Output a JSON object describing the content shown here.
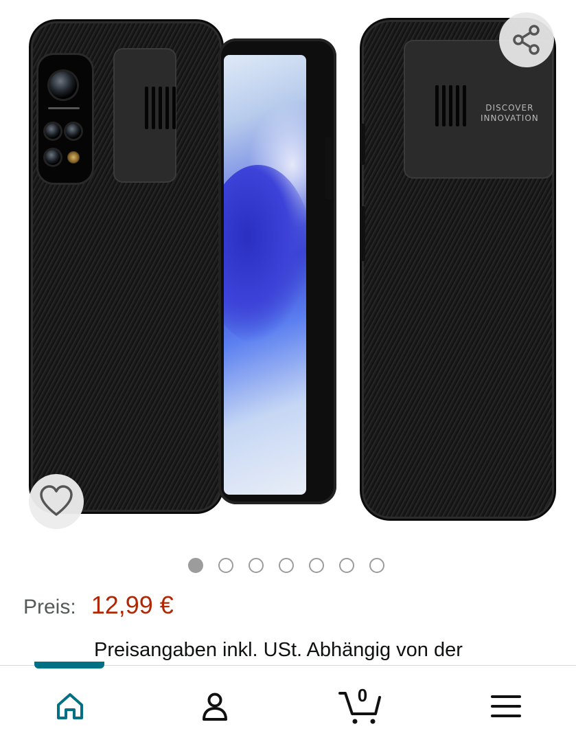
{
  "gallery": {
    "image_alt": "phone-case-product-image",
    "current_index": 1,
    "total_images": 7,
    "case_lettering": [
      "DISCOVER",
      "INNOVATION"
    ]
  },
  "actions": {
    "share_icon": "share-icon",
    "favorite_icon": "heart-outline-icon"
  },
  "price": {
    "label": "Preis:",
    "value": "12,99 €"
  },
  "tax_note": "Preisangaben inkl. USt. Abhängig von der",
  "nav": {
    "items": [
      {
        "name": "home",
        "icon": "home-icon"
      },
      {
        "name": "account",
        "icon": "person-icon"
      },
      {
        "name": "cart",
        "icon": "cart-icon",
        "count": "0"
      },
      {
        "name": "menu",
        "icon": "hamburger-menu-icon"
      }
    ]
  },
  "colors": {
    "price": "#b12704",
    "accent": "#007185",
    "text": "#0f1111",
    "label": "#565959"
  }
}
